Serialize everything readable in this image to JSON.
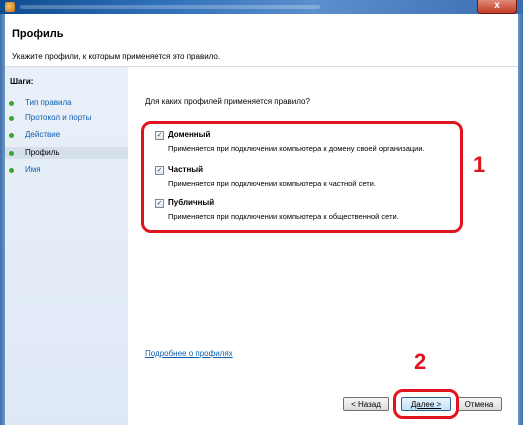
{
  "window": {
    "close_glyph": "x"
  },
  "header": {
    "title": "Профиль",
    "subtitle": "Укажите профили, к которым применяется это правило."
  },
  "sidebar": {
    "heading": "Шаги:",
    "steps": [
      {
        "label": "Тип правила",
        "current": false
      },
      {
        "label": "Протокол и порты",
        "current": false
      },
      {
        "label": "Действие",
        "current": false
      },
      {
        "label": "Профиль",
        "current": true
      },
      {
        "label": "Имя",
        "current": false
      }
    ]
  },
  "main": {
    "question": "Для каких профилей применяется правило?",
    "profiles": [
      {
        "label": "Доменный",
        "checked": true,
        "description": "Применяется при подключении компьютера к домену своей организации."
      },
      {
        "label": "Частный",
        "checked": true,
        "description": "Применяется при подключении компьютера к частной сети."
      },
      {
        "label": "Публичный",
        "checked": true,
        "description": "Применяется при подключении компьютера к общественной сети."
      }
    ],
    "more_link": "Подробнее о профилях"
  },
  "buttons": {
    "back": "< Назад",
    "next": "Далее >",
    "cancel": "Отмена"
  },
  "annotations": {
    "marker1": "1",
    "marker2": "2",
    "highlight_color": "#e0141e"
  },
  "colors": {
    "titlebar": "#2e6fb9",
    "link": "#0c5fb0",
    "step_dot": "#3aa52f"
  }
}
